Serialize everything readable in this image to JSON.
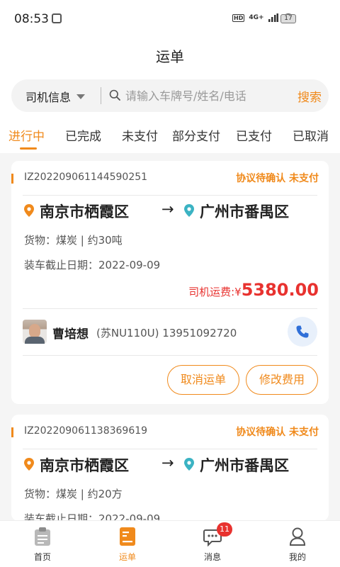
{
  "status_bar": {
    "time": "08:53",
    "hd": "HD",
    "signal": "4G+",
    "battery": "17"
  },
  "header": {
    "title": "运单"
  },
  "search": {
    "filter_label": "司机信息",
    "placeholder": "请输入车牌号/姓名/电话",
    "button": "搜索"
  },
  "tabs": [
    {
      "label": "进行中",
      "active": true
    },
    {
      "label": "已完成"
    },
    {
      "label": "未支付"
    },
    {
      "label": "部分支付"
    },
    {
      "label": "已支付"
    },
    {
      "label": "已取消"
    }
  ],
  "orders": [
    {
      "order_no": "IZ202209061144590251",
      "status": "协议待确认 未支付",
      "from": "南京市栖霞区",
      "to": "广州市番禺区",
      "cargo": "货物：煤炭 | 约30吨",
      "deadline": "装车截止日期：2022-09-09",
      "fee_label": "司机运费:¥",
      "fee_amount": "5380.00",
      "driver_name": "曹培想",
      "driver_meta": "(苏NU110U) 13951092720",
      "buttons": [
        "取消运单",
        "修改费用"
      ]
    },
    {
      "order_no": "IZ202209061138369619",
      "status": "协议待确认 未支付",
      "from": "南京市栖霞区",
      "to": "广州市番禺区",
      "cargo": "货物：煤炭 | 约20方",
      "deadline": "装车截止日期：2022-09-09"
    }
  ],
  "bottom_nav": [
    {
      "label": "首页",
      "icon": "clipboard-icon"
    },
    {
      "label": "运单",
      "icon": "waybill-icon",
      "active": true
    },
    {
      "label": "消息",
      "icon": "message-icon",
      "badge": "11"
    },
    {
      "label": "我的",
      "icon": "profile-icon"
    }
  ],
  "colors": {
    "accent": "#f08a1c",
    "price": "#e8322f",
    "pin_from": "#f08a1c",
    "pin_to": "#3bb3c3"
  }
}
